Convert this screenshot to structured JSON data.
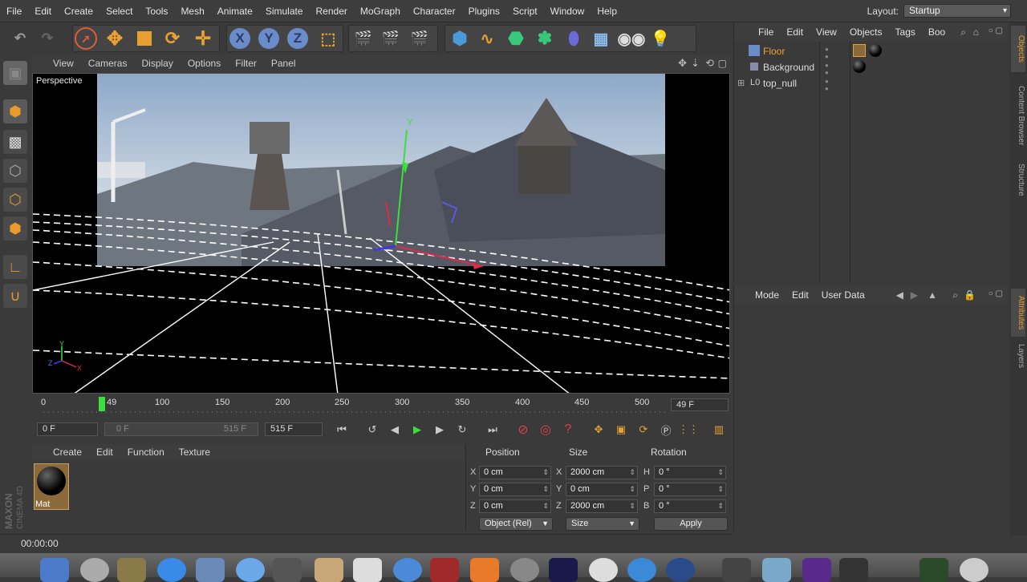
{
  "menubar": {
    "items": [
      "File",
      "Edit",
      "Create",
      "Select",
      "Tools",
      "Mesh",
      "Animate",
      "Simulate",
      "Render",
      "MoGraph",
      "Character",
      "Plugins",
      "Script",
      "Window",
      "Help"
    ],
    "layout_label": "Layout:",
    "layout_value": "Startup"
  },
  "toolbar": {
    "x_label": "X",
    "y_label": "Y",
    "z_label": "Z"
  },
  "viewport": {
    "menu": [
      "View",
      "Cameras",
      "Display",
      "Options",
      "Filter",
      "Panel"
    ],
    "label": "Perspective",
    "axis_x": "X",
    "axis_y": "Y",
    "axis_z": "Z",
    "gizmo_y": "Y"
  },
  "timeline": {
    "ticks": [
      "0",
      "49",
      "100",
      "150",
      "200",
      "250",
      "300",
      "350",
      "400",
      "450",
      "500"
    ],
    "current_frame": "49 F"
  },
  "playback": {
    "start_frame": "0 F",
    "range_start": "0 F",
    "range_end": "515 F",
    "end_frame": "515 F"
  },
  "material_manager": {
    "menu": [
      "Create",
      "Edit",
      "Function",
      "Texture"
    ],
    "materials": [
      {
        "name": "Mat"
      }
    ]
  },
  "coordinates": {
    "headers": {
      "position": "Position",
      "size": "Size",
      "rotation": "Rotation"
    },
    "rows": [
      {
        "axis": "X",
        "pos": "0 cm",
        "size_axis": "X",
        "size": "2000 cm",
        "rot_axis": "H",
        "rot": "0 °"
      },
      {
        "axis": "Y",
        "pos": "0 cm",
        "size_axis": "Y",
        "size": "0 cm",
        "rot_axis": "P",
        "rot": "0 °"
      },
      {
        "axis": "Z",
        "pos": "0 cm",
        "size_axis": "Z",
        "size": "2000 cm",
        "rot_axis": "B",
        "rot": "0 °"
      }
    ],
    "mode_select": "Object (Rel)",
    "size_select": "Size",
    "apply_label": "Apply"
  },
  "object_manager": {
    "menu": [
      "File",
      "Edit",
      "View",
      "Objects",
      "Tags",
      "Boo"
    ],
    "objects": [
      {
        "name": "Floor",
        "color": "#f0a030"
      },
      {
        "name": "Background",
        "color": "#dddddd"
      },
      {
        "name": "top_null",
        "color": "#dddddd"
      }
    ]
  },
  "attributes": {
    "menu": [
      "Mode",
      "Edit",
      "User Data"
    ]
  },
  "side_tabs": {
    "objects": "Objects",
    "content_browser": "Content Browser",
    "structure": "Structure",
    "attributes": "Attributes",
    "layers": "Layers"
  },
  "status": {
    "time": "00:00:00"
  },
  "brand": {
    "line1": "MAXON",
    "line2": "CINEMA 4D"
  },
  "colors": {
    "accent": "#e8a030",
    "selection": "#4a78b0"
  }
}
